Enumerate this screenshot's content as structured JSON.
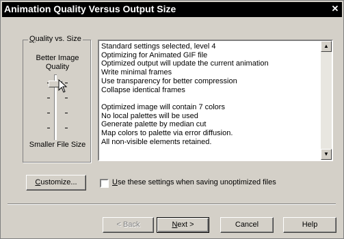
{
  "window": {
    "title": "Animation Quality Versus Output Size",
    "close_glyph": "✕"
  },
  "quality_group": {
    "label": "Quality vs. Size",
    "top_label": "Better Image Quality",
    "bottom_label": "Smaller File Size",
    "slider_level": 4
  },
  "settings_list": {
    "lines_a": [
      "Standard settings selected, level 4",
      "Optimizing for Animated GIF file",
      "Optimized output will update the current animation",
      "Write minimal frames",
      "Use transparency for better compression",
      "Collapse identical frames"
    ],
    "lines_b": [
      "Optimized image will contain 7 colors",
      "No local palettes will be used",
      "Generate palette by median cut",
      "Map colors to palette via error diffusion.",
      "All non-visible elements retained."
    ]
  },
  "customize_button": "Customize...",
  "use_settings_checkbox": {
    "label": "Use these settings when saving unoptimized files",
    "checked": false
  },
  "buttons": {
    "back": "< Back",
    "next": "Next >",
    "cancel": "Cancel",
    "help": "Help"
  }
}
